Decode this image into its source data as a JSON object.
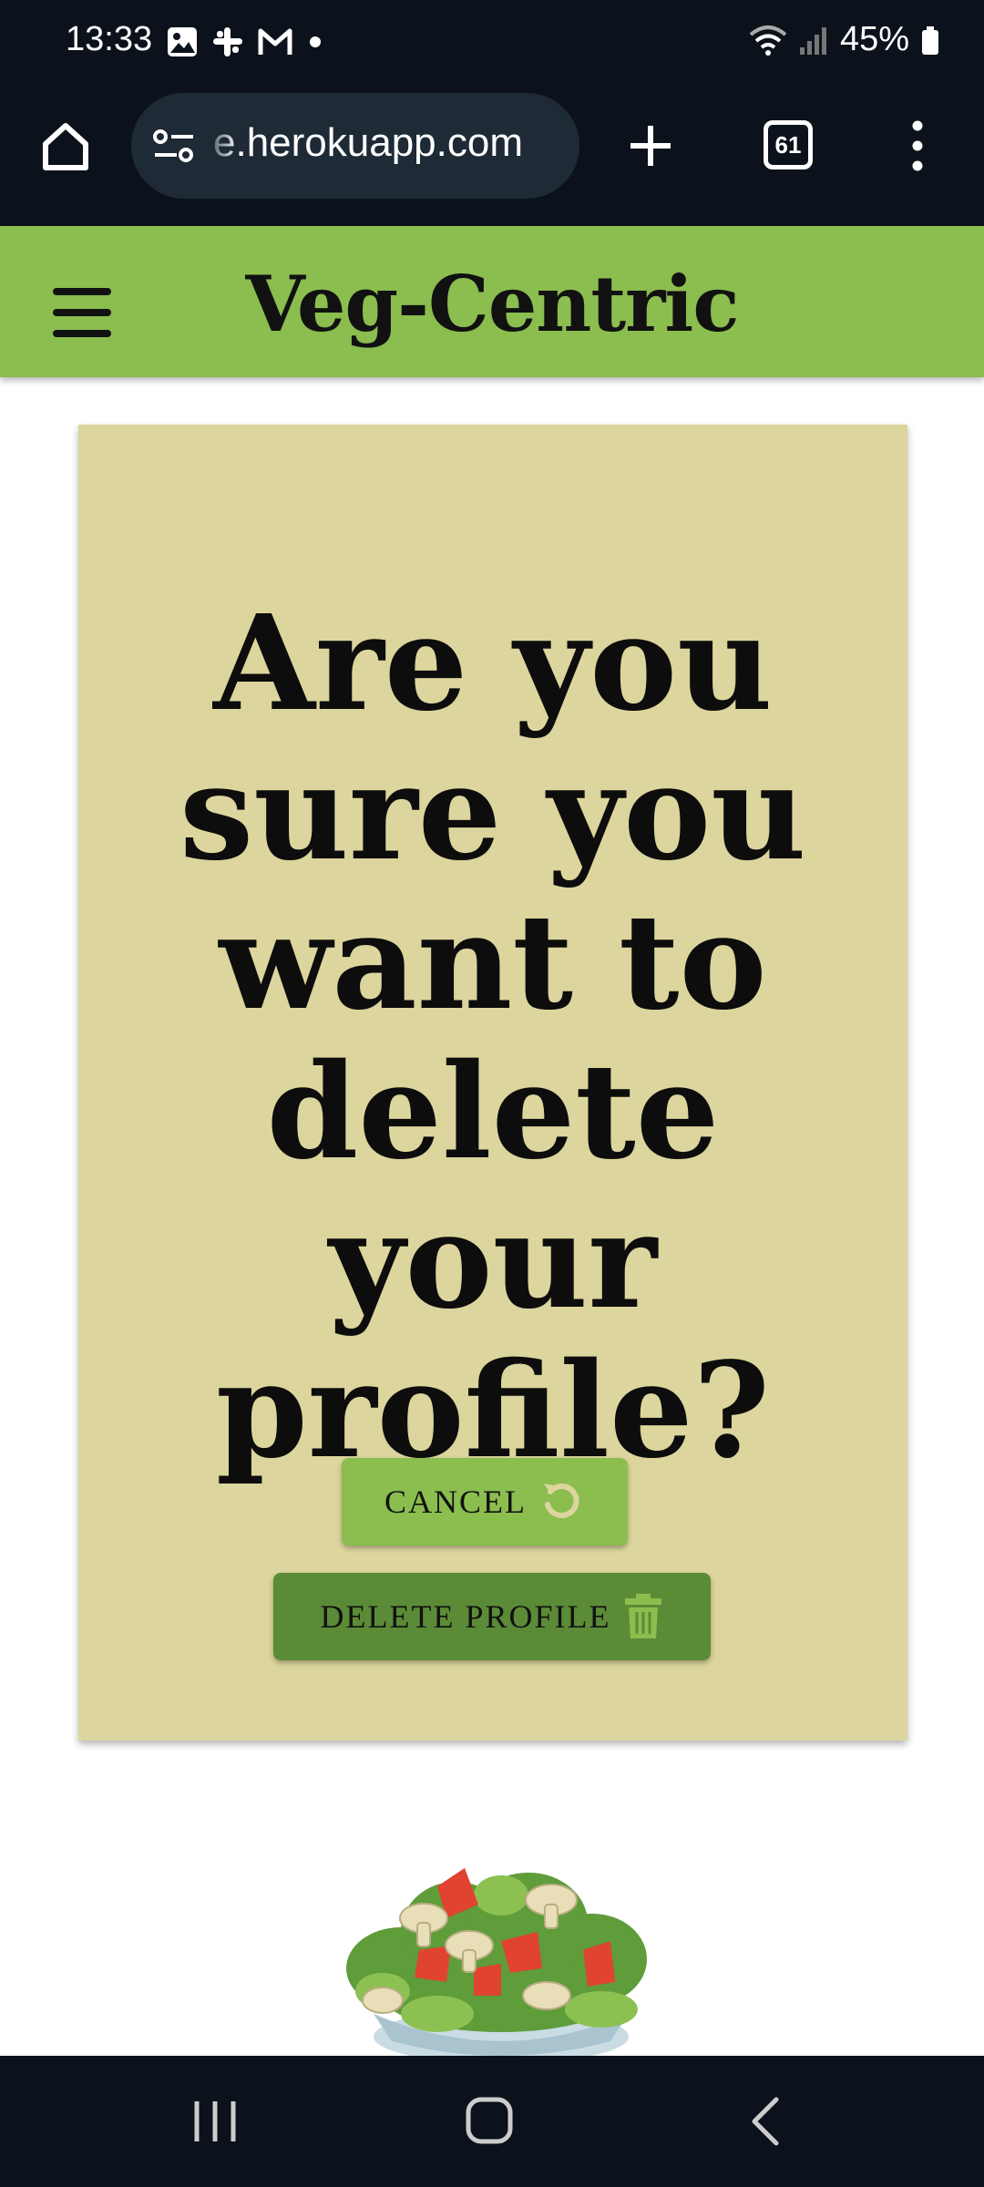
{
  "status_bar": {
    "time": "13:33",
    "battery": "45%",
    "left_icons": [
      "gallery-icon",
      "slack-icon",
      "gmail-icon",
      "dot-icon"
    ],
    "right_icons": [
      "wifi-icon",
      "signal-icon",
      "battery-icon"
    ]
  },
  "browser": {
    "url": "e.herokuapp.com",
    "tab_count": "61"
  },
  "header": {
    "brand": "Veg-Centric",
    "bg_color": "#8bbd4f"
  },
  "dialog": {
    "heading": "Are you sure you want to delete your profile?",
    "cancel_label": "CANCEL",
    "delete_label": "DELETE PROFILE",
    "card_color": "#dcd59d",
    "cancel_color": "#8bbd4f",
    "delete_color": "#5b8b37"
  }
}
